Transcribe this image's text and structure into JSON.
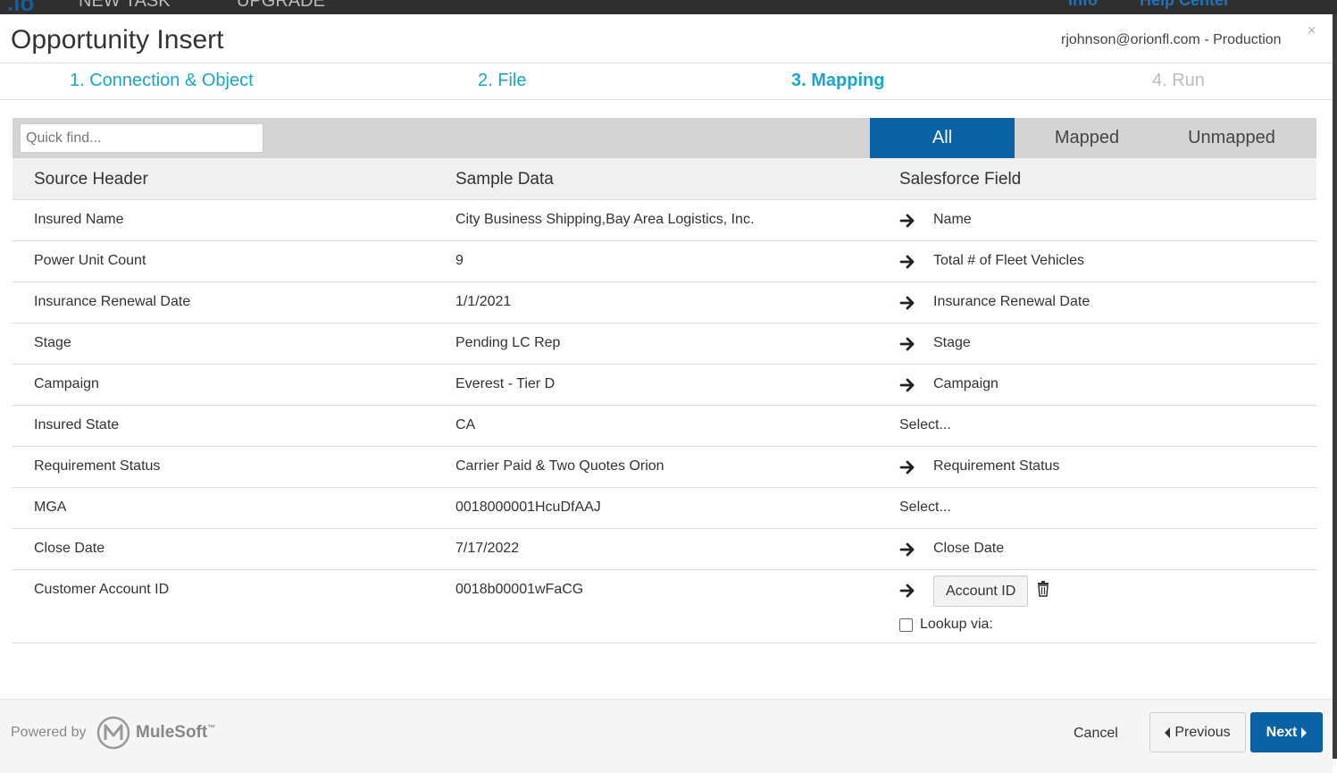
{
  "topbar": {
    "logo": ".io",
    "new_task": "NEW TASK",
    "upgrade": "UPGRADE",
    "info": "Info",
    "help_center": "Help Center"
  },
  "modal": {
    "title": "Opportunity Insert",
    "account": "rjohnson@orionfl.com - Production",
    "close": "×"
  },
  "steps": [
    {
      "label": "1. Connection & Object",
      "state": "done"
    },
    {
      "label": "2. File",
      "state": "done"
    },
    {
      "label": "3. Mapping",
      "state": "active"
    },
    {
      "label": "4. Run",
      "state": "pending"
    }
  ],
  "filter": {
    "placeholder": "Quick find...",
    "all": "All",
    "mapped": "Mapped",
    "unmapped": "Unmapped",
    "active": "All"
  },
  "columns": {
    "source": "Source Header",
    "sample": "Sample Data",
    "field": "Salesforce Field"
  },
  "rows": [
    {
      "source": "Insured Name",
      "sample": "City Business Shipping,Bay Area Logistics, Inc.",
      "field": "Name",
      "mapped": true
    },
    {
      "source": "Power Unit Count",
      "sample": "9",
      "field": "Total # of Fleet Vehicles",
      "mapped": true
    },
    {
      "source": "Insurance Renewal Date",
      "sample": "1/1/2021",
      "field": "Insurance Renewal Date",
      "mapped": true
    },
    {
      "source": "Stage",
      "sample": "Pending LC Rep",
      "field": "Stage",
      "mapped": true
    },
    {
      "source": "Campaign",
      "sample": "Everest - Tier D",
      "field": "Campaign",
      "mapped": true
    },
    {
      "source": "Insured State",
      "sample": "CA",
      "field": "Select...",
      "mapped": false
    },
    {
      "source": "Requirement Status",
      "sample": "Carrier Paid & Two Quotes Orion",
      "field": "Requirement Status",
      "mapped": true
    },
    {
      "source": "MGA",
      "sample": "0018000001HcuDfAAJ",
      "field": "Select...",
      "mapped": false
    },
    {
      "source": "Close Date",
      "sample": "7/17/2022",
      "field": "Close Date",
      "mapped": true
    },
    {
      "source": "Customer Account ID",
      "sample": "0018b00001wFaCG",
      "field": "Account ID",
      "mapped": true,
      "lookup_label": "Lookup via:"
    }
  ],
  "footer": {
    "powered_by": "Powered by",
    "brand": "MuleSoft",
    "tm": "™",
    "cancel": "Cancel",
    "previous": "Previous",
    "next": "Next"
  },
  "colors": {
    "accent": "#0b63a5",
    "step_link": "#1aa6c8",
    "step_pending": "#bdbdbd"
  }
}
